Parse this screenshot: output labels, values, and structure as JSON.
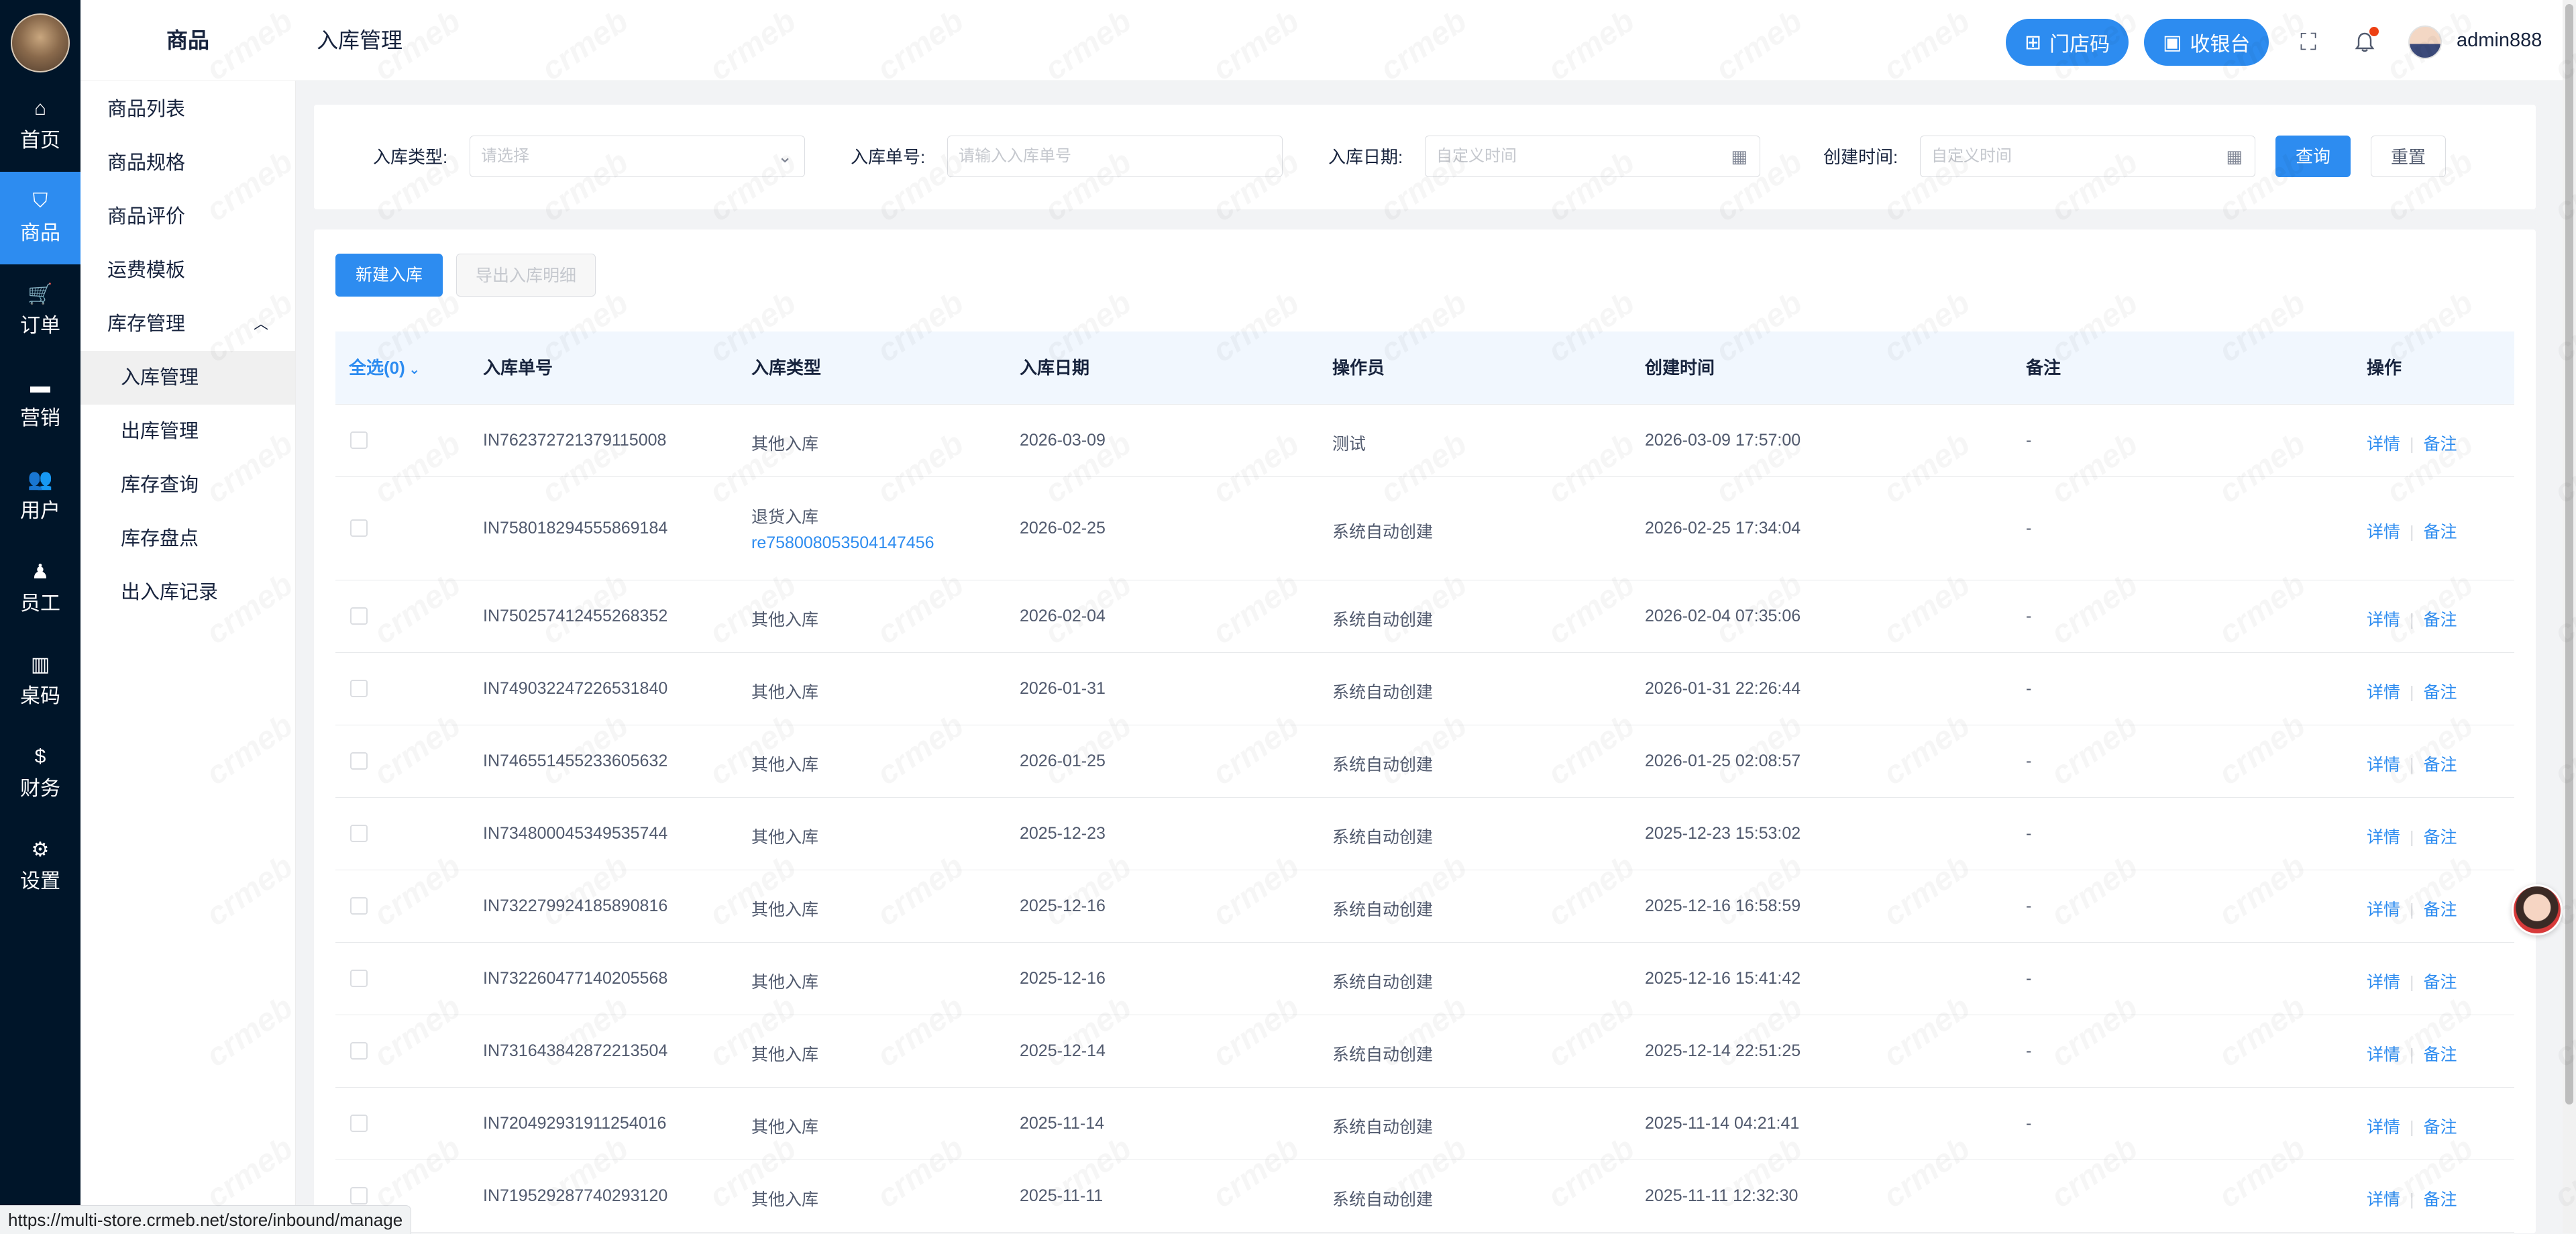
{
  "nav": {
    "items": [
      {
        "label": "首页",
        "icon": "home-icon",
        "glyph": "⌂"
      },
      {
        "label": "商品",
        "icon": "bag-icon",
        "glyph": "⛉"
      },
      {
        "label": "订单",
        "icon": "cart-icon",
        "glyph": "🛒"
      },
      {
        "label": "营销",
        "icon": "briefcase-icon",
        "glyph": "▬"
      },
      {
        "label": "用户",
        "icon": "users-icon",
        "glyph": "👥"
      },
      {
        "label": "员工",
        "icon": "person-icon",
        "glyph": "♟"
      },
      {
        "label": "桌码",
        "icon": "map-icon",
        "glyph": "▥"
      },
      {
        "label": "财务",
        "icon": "dollar-icon",
        "glyph": "$"
      },
      {
        "label": "设置",
        "icon": "gear-icon",
        "glyph": "⚙"
      }
    ]
  },
  "menu": {
    "title": "商品",
    "items": [
      "商品列表",
      "商品规格",
      "商品评价",
      "运费模板"
    ],
    "group": "库存管理",
    "sub": [
      "入库管理",
      "出库管理",
      "库存查询",
      "库存盘点",
      "出入库记录"
    ]
  },
  "header": {
    "breadcrumb": "入库管理",
    "store_code": "门店码",
    "cashier": "收银台",
    "user": "admin888"
  },
  "filter": {
    "type_label": "入库类型:",
    "type_placeholder": "请选择",
    "no_label": "入库单号:",
    "no_placeholder": "请输入入库单号",
    "date_label": "入库日期:",
    "date_placeholder": "自定义时间",
    "created_label": "创建时间:",
    "created_placeholder": "自定义时间",
    "query": "查询",
    "reset": "重置"
  },
  "toolbar": {
    "new_label": "新建入库",
    "export_label": "导出入库明细"
  },
  "table": {
    "select_all": "全选(0)",
    "columns": [
      "入库单号",
      "入库类型",
      "入库日期",
      "操作员",
      "创建时间",
      "备注",
      "操作"
    ],
    "action_detail": "详情",
    "action_remark": "备注",
    "rows": [
      {
        "no": "IN762372721379115008",
        "type": "其他入库",
        "ref": "",
        "date": "2026-03-09",
        "operator": "测试",
        "created": "2026-03-09 17:57:00",
        "remark": "-"
      },
      {
        "no": "IN758018294555869184",
        "type": "退货入库",
        "ref": "re758008053504147456",
        "date": "2026-02-25",
        "operator": "系统自动创建",
        "created": "2026-02-25 17:34:04",
        "remark": "-"
      },
      {
        "no": "IN750257412455268352",
        "type": "其他入库",
        "ref": "",
        "date": "2026-02-04",
        "operator": "系统自动创建",
        "created": "2026-02-04 07:35:06",
        "remark": "-"
      },
      {
        "no": "IN749032247226531840",
        "type": "其他入库",
        "ref": "",
        "date": "2026-01-31",
        "operator": "系统自动创建",
        "created": "2026-01-31 22:26:44",
        "remark": "-"
      },
      {
        "no": "IN746551455233605632",
        "type": "其他入库",
        "ref": "",
        "date": "2026-01-25",
        "operator": "系统自动创建",
        "created": "2026-01-25 02:08:57",
        "remark": "-"
      },
      {
        "no": "IN734800045349535744",
        "type": "其他入库",
        "ref": "",
        "date": "2025-12-23",
        "operator": "系统自动创建",
        "created": "2025-12-23 15:53:02",
        "remark": "-"
      },
      {
        "no": "IN732279924185890816",
        "type": "其他入库",
        "ref": "",
        "date": "2025-12-16",
        "operator": "系统自动创建",
        "created": "2025-12-16 16:58:59",
        "remark": "-"
      },
      {
        "no": "IN732260477140205568",
        "type": "其他入库",
        "ref": "",
        "date": "2025-12-16",
        "operator": "系统自动创建",
        "created": "2025-12-16 15:41:42",
        "remark": "-"
      },
      {
        "no": "IN731643842872213504",
        "type": "其他入库",
        "ref": "",
        "date": "2025-12-14",
        "operator": "系统自动创建",
        "created": "2025-12-14 22:51:25",
        "remark": "-"
      },
      {
        "no": "IN720492931911254016",
        "type": "其他入库",
        "ref": "",
        "date": "2025-11-14",
        "operator": "系统自动创建",
        "created": "2025-11-14 04:21:41",
        "remark": "-"
      },
      {
        "no": "IN719529287740293120",
        "type": "其他入库",
        "ref": "",
        "date": "2025-11-11",
        "operator": "系统自动创建",
        "created": "2025-11-11 12:32:30",
        "remark": ""
      }
    ]
  },
  "watermark_text": "crmeb",
  "status_url": "https://multi-store.crmeb.net/store/inbound/manage",
  "colors": {
    "primary": "#2d8cf0",
    "nav_bg": "#001529",
    "header_row_bg": "#f1f7fe"
  }
}
